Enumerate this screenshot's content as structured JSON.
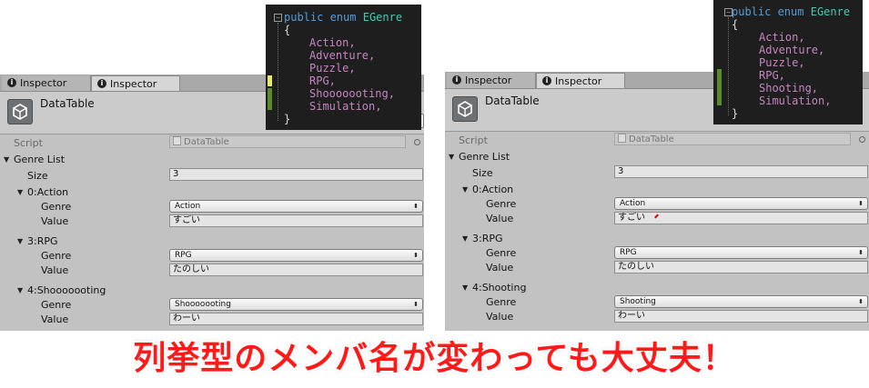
{
  "left": {
    "tabs": [
      {
        "label": "Inspector",
        "active": false
      },
      {
        "label": "Inspector",
        "active": true
      }
    ],
    "object_title": "DataTable",
    "script_label": "Script",
    "script_value": "DataTable",
    "list_label": "Genre List",
    "size_label": "Size",
    "size_value": "3",
    "elements": [
      {
        "header": "0:Action",
        "genre_label": "Genre",
        "genre_value": "Action",
        "value_label": "Value",
        "value_value": "すごい"
      },
      {
        "header": "3:RPG",
        "genre_label": "Genre",
        "genre_value": "RPG",
        "value_label": "Value",
        "value_value": "たのしい"
      },
      {
        "header": "4:Shooooooting",
        "genre_label": "Genre",
        "genre_value": "Shooooooting",
        "value_label": "Value",
        "value_value": "わーい"
      }
    ]
  },
  "right": {
    "tabs": [
      {
        "label": "Inspector",
        "active": false
      },
      {
        "label": "Inspector",
        "active": true
      }
    ],
    "object_title": "DataTable",
    "script_label": "Script",
    "script_value": "DataTable",
    "list_label": "Genre List",
    "size_label": "Size",
    "size_value": "3",
    "elements": [
      {
        "header": "0:Action",
        "genre_label": "Genre",
        "genre_value": "Action",
        "value_label": "Value",
        "value_value": "すごい"
      },
      {
        "header": "3:RPG",
        "genre_label": "Genre",
        "genre_value": "RPG",
        "value_label": "Value",
        "value_value": "たのしい"
      },
      {
        "header": "4:Shooting",
        "genre_label": "Genre",
        "genre_value": "Shooting",
        "value_label": "Value",
        "value_value": "わーい"
      }
    ]
  },
  "code_left": {
    "decl": {
      "kw": "public enum",
      "name": "EGenre"
    },
    "open": "{",
    "members": [
      "Action,",
      "Adventure,",
      "Puzzle,",
      "RPG,",
      "Shooooooting,",
      "Simulation,"
    ],
    "close": "}"
  },
  "code_right": {
    "decl": {
      "kw": "public enum",
      "name": "EGenre"
    },
    "open": "{",
    "members": [
      "Action,",
      "Adventure,",
      "Puzzle,",
      "RPG,",
      "Shooting,",
      "Simulation,"
    ],
    "close": "}"
  },
  "caption": "列挙型のメンバ名が変わっても大丈夫！",
  "colors": {
    "caption": "#ff1a1a",
    "keyword": "#569cd6",
    "type": "#4ec9b0",
    "member": "#c586c0"
  },
  "icons": {
    "tab": "info-icon",
    "object": "unity-logo-icon",
    "script": "script-file-icon",
    "target": "object-picker-icon",
    "dropdown": "dropdown-arrow-icon",
    "foldout": "foldout-arrow-icon"
  }
}
